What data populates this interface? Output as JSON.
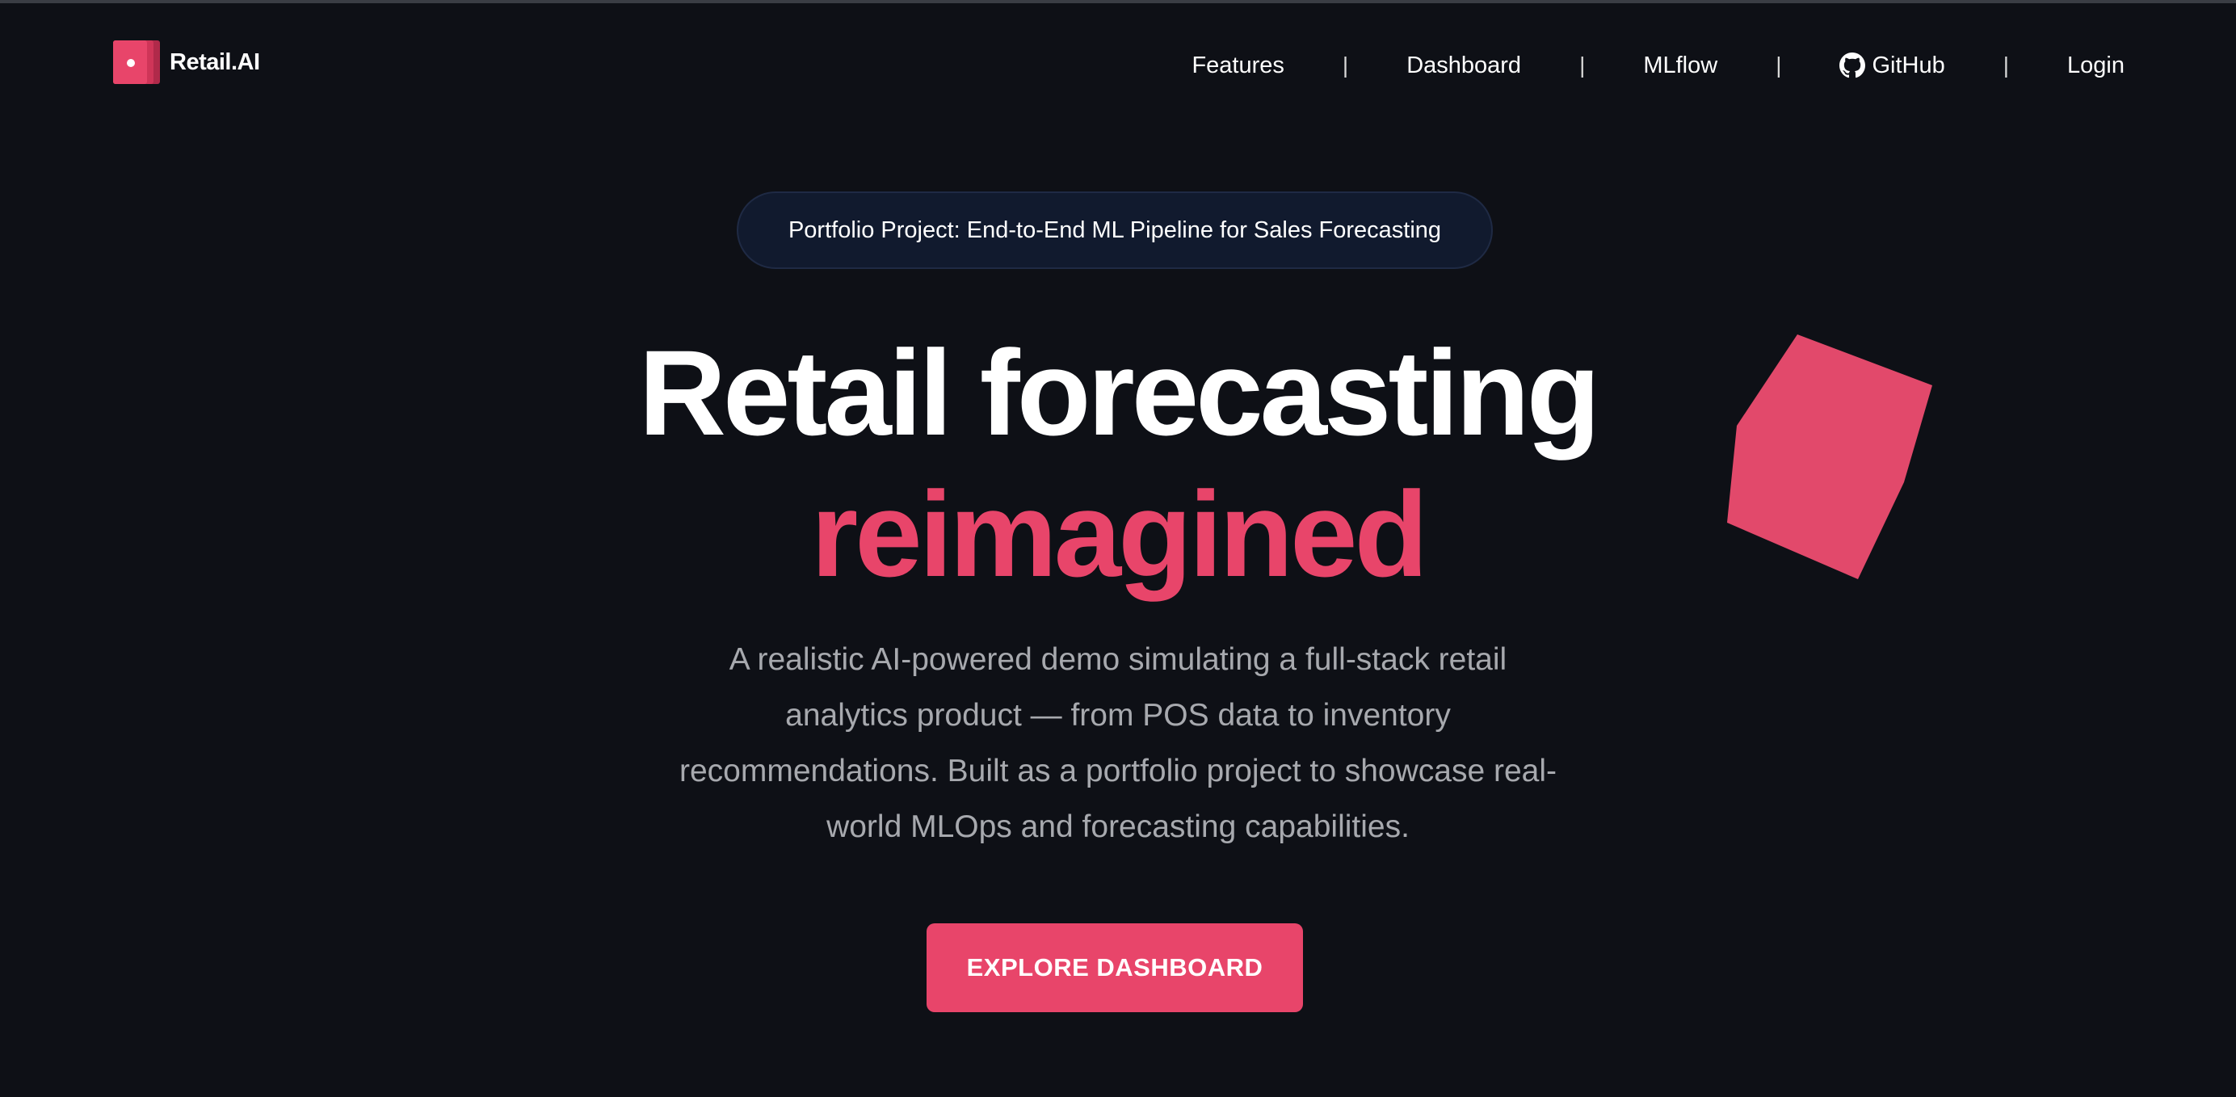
{
  "brand": {
    "name": "Retail.AI",
    "color": "#e8456a"
  },
  "nav": {
    "items": [
      {
        "label": "Features"
      },
      {
        "label": "Dashboard"
      },
      {
        "label": "MLflow"
      },
      {
        "label": "GitHub",
        "icon": "github-icon"
      },
      {
        "label": "Login"
      }
    ],
    "separator": "|"
  },
  "hero": {
    "badge": "Portfolio Project: End-to-End ML Pipeline for Sales Forecasting",
    "headline_line1": "Retail forecasting",
    "headline_line2": "reimagined",
    "subtitle": "A realistic AI-powered demo simulating a full-stack retail analytics product — from POS data to inventory recommendations. Built as a portfolio project to showcase real-world MLOps and forecasting capabilities.",
    "cta_label": "EXPLORE DASHBOARD"
  },
  "colors": {
    "background": "#0e1016",
    "accent": "#e8456a",
    "badge_bg": "#111a2e",
    "muted_text": "#a7a9ae"
  }
}
